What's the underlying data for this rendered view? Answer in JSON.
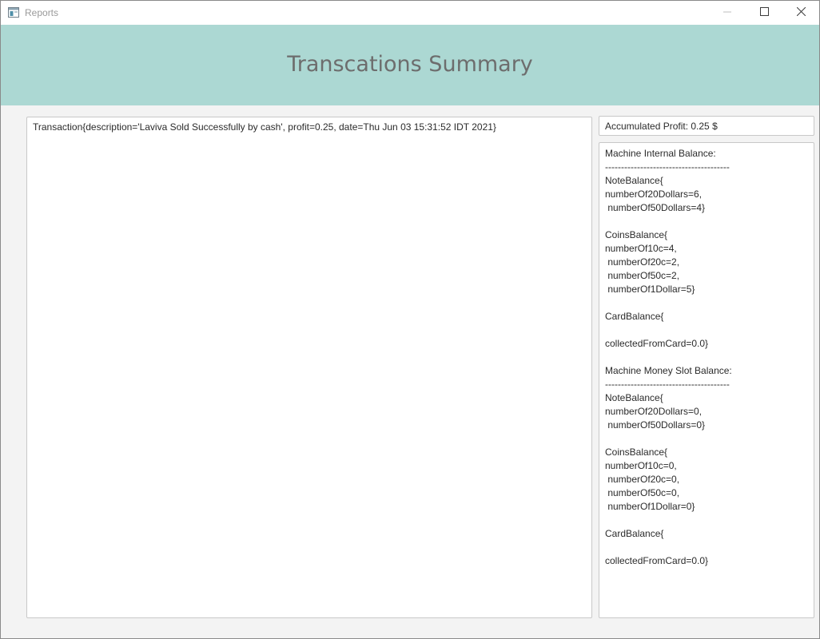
{
  "window": {
    "title": "Reports",
    "icon": "app-window-icon"
  },
  "header": {
    "title": "Transcations Summary",
    "background": "#acd8d3"
  },
  "transactions": [
    "Transaction{description='Laviva Sold Successfully by cash', profit=0.25, date=Thu Jun 03 15:31:52 IDT 2021}"
  ],
  "profit": {
    "text": "Accumulated Profit: 0.25 $"
  },
  "balance_lines": [
    "Machine Internal Balance:",
    "---------------------------------------",
    "NoteBalance{",
    "numberOf20Dollars=6,",
    " numberOf50Dollars=4}",
    "",
    "CoinsBalance{",
    "numberOf10c=4,",
    " numberOf20c=2,",
    " numberOf50c=2,",
    " numberOf1Dollar=5}",
    "",
    "CardBalance{",
    "",
    "collectedFromCard=0.0}",
    "",
    "Machine Money Slot Balance:",
    "---------------------------------------",
    "NoteBalance{",
    "numberOf20Dollars=0,",
    " numberOf50Dollars=0}",
    "",
    "CoinsBalance{",
    "numberOf10c=0,",
    " numberOf20c=0,",
    " numberOf50c=0,",
    " numberOf1Dollar=0}",
    "",
    "CardBalance{",
    "",
    "collectedFromCard=0.0}"
  ]
}
